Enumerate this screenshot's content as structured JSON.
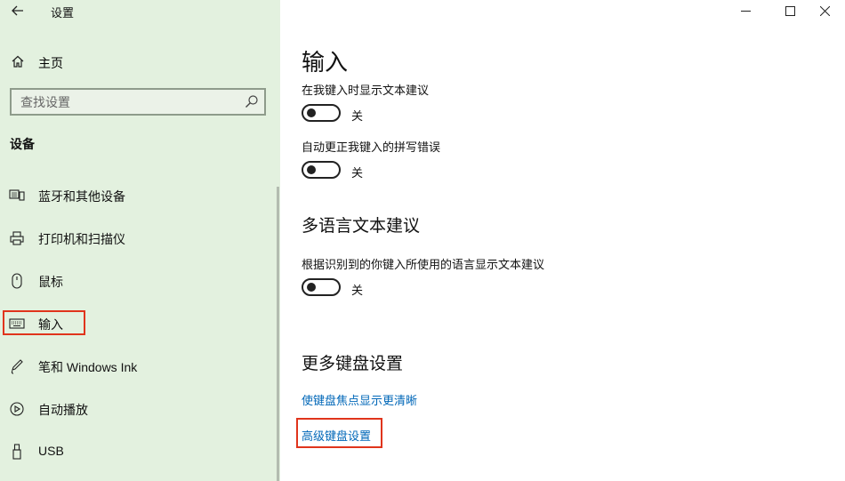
{
  "window": {
    "title": "设置",
    "controls": {
      "minimize": "—",
      "maximize": "☐",
      "close": "✕"
    }
  },
  "sidebar": {
    "home_label": "主页",
    "search_placeholder": "查找设置",
    "section_title": "设备",
    "items": [
      {
        "label": "蓝牙和其他设备",
        "icon": "bluetooth-devices-icon"
      },
      {
        "label": "打印机和扫描仪",
        "icon": "printer-icon"
      },
      {
        "label": "鼠标",
        "icon": "mouse-icon"
      },
      {
        "label": "输入",
        "icon": "keyboard-icon",
        "active": true
      },
      {
        "label": "笔和 Windows Ink",
        "icon": "pen-icon"
      },
      {
        "label": "自动播放",
        "icon": "autoplay-icon"
      },
      {
        "label": "USB",
        "icon": "usb-icon"
      }
    ]
  },
  "main": {
    "title": "输入",
    "options": [
      {
        "label": "在我键入时显示文本建议",
        "state": "关",
        "on": false
      },
      {
        "label": "自动更正我键入的拼写错误",
        "state": "关",
        "on": false
      }
    ],
    "multilang": {
      "heading": "多语言文本建议",
      "option": {
        "label": "根据识别到的你键入所使用的语言显示文本建议",
        "state": "关",
        "on": false
      }
    },
    "more_keyboard": {
      "heading": "更多键盘设置",
      "links": [
        "使键盘焦点显示更清晰",
        "高级键盘设置"
      ]
    }
  },
  "colors": {
    "sidebar_bg": "#e3f1df",
    "link": "#0067b8",
    "highlight": "#e0341c"
  }
}
